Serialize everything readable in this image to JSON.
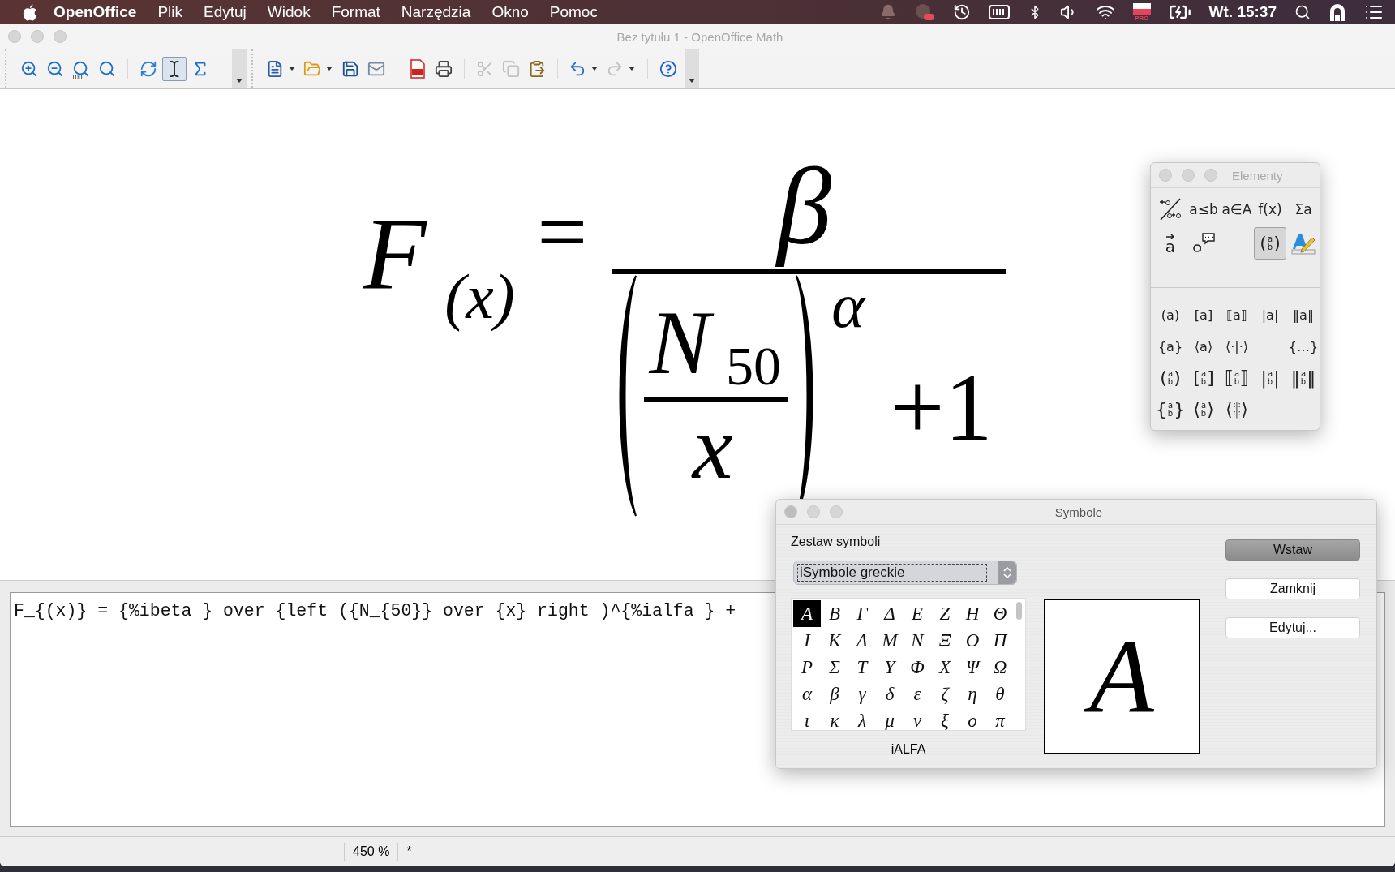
{
  "menu_bar": {
    "app": "OpenOffice",
    "menus": [
      "Plik",
      "Edytuj",
      "Widok",
      "Format",
      "Narzędzia",
      "Okno",
      "Pomoc"
    ],
    "flag_badge": "PRO",
    "clock": "Wt. 15:37"
  },
  "window": {
    "title": "Bez tytułu 1 - OpenOffice Math"
  },
  "toolbars": [
    {
      "items": [
        {
          "selected": false,
          "disabled": false,
          "dropdown": false
        },
        {
          "selected": false,
          "disabled": false,
          "dropdown": false
        },
        {
          "selected": false,
          "disabled": false,
          "dropdown": false,
          "label": "100"
        },
        {
          "selected": false,
          "disabled": false,
          "dropdown": false
        },
        {
          "selected": false,
          "disabled": false,
          "dropdown": false
        },
        {
          "selected": true,
          "disabled": false,
          "dropdown": false
        },
        {
          "selected": false,
          "disabled": false,
          "dropdown": false
        }
      ]
    },
    {
      "items": [
        {
          "selected": false,
          "disabled": false,
          "dropdown": true
        },
        {
          "selected": false,
          "disabled": false,
          "dropdown": true
        },
        {
          "selected": false,
          "disabled": false,
          "dropdown": false
        },
        {
          "selected": false,
          "disabled": false,
          "dropdown": false
        },
        {
          "selected": false,
          "disabled": false,
          "dropdown": false
        },
        {
          "selected": false,
          "disabled": false,
          "dropdown": false
        },
        {
          "selected": false,
          "disabled": true,
          "dropdown": false
        },
        {
          "selected": false,
          "disabled": true,
          "dropdown": false
        },
        {
          "selected": false,
          "disabled": false,
          "dropdown": false
        },
        {
          "selected": false,
          "disabled": false,
          "dropdown": true
        },
        {
          "selected": false,
          "disabled": true,
          "dropdown": true
        },
        {
          "selected": false,
          "disabled": false,
          "dropdown": false
        }
      ]
    }
  ],
  "formula": {
    "function": "F",
    "argument": "(x)",
    "equals": "=",
    "numerator": "β",
    "inner_numerator": "N",
    "inner_subscript": "50",
    "inner_denominator": "x",
    "exponent": "α",
    "addend": "+1"
  },
  "editor": {
    "text": "F_{(x)} = {%ibeta } over {left ({N_{50}} over {x} right )^{%ialfa } +"
  },
  "status_bar": {
    "zoom": "450 %",
    "modified": "*"
  },
  "elements_panel": {
    "title": "Elementy",
    "categories": [
      {
        "kind": "icon",
        "selected": false
      },
      {
        "kind": "text",
        "label": "a≤b",
        "selected": false
      },
      {
        "kind": "text",
        "label": "a∈A",
        "selected": false
      },
      {
        "kind": "text",
        "label": "f(x)",
        "selected": false
      },
      {
        "kind": "text",
        "label": "Σa",
        "selected": false
      },
      {
        "kind": "vector",
        "label": "a",
        "selected": false
      },
      {
        "kind": "icon",
        "selected": false
      },
      {
        "kind": "blank"
      },
      {
        "kind": "stack",
        "open": "(",
        "top": "a",
        "bottom": "b",
        "close": ")",
        "selected": true
      },
      {
        "kind": "icon",
        "selected": false
      }
    ],
    "brackets": [
      [
        {
          "kind": "single",
          "open": "(",
          "content": "a",
          "close": ")"
        },
        {
          "kind": "single",
          "open": "[",
          "content": "a",
          "close": "]"
        },
        {
          "kind": "single",
          "open": "⟦",
          "content": "a",
          "close": "⟧"
        },
        {
          "kind": "single",
          "open": "|",
          "content": "a",
          "close": "|"
        },
        {
          "kind": "single",
          "open": "‖",
          "content": "a",
          "close": "‖"
        }
      ],
      [
        {
          "kind": "single",
          "open": "{",
          "content": "a",
          "close": "}"
        },
        {
          "kind": "single",
          "open": "⟨",
          "content": "a",
          "close": "⟩"
        },
        {
          "kind": "single",
          "open": "⟨",
          "content": "·|·",
          "close": "⟩"
        },
        {
          "kind": "blank"
        },
        {
          "kind": "single",
          "open": "{",
          "content": "…",
          "close": "}"
        }
      ],
      [
        {
          "kind": "stack",
          "open": "(",
          "top": "a",
          "bottom": "b",
          "close": ")"
        },
        {
          "kind": "stack",
          "open": "[",
          "top": "a",
          "bottom": "b",
          "close": "]"
        },
        {
          "kind": "stack",
          "open": "⟦",
          "top": "a",
          "bottom": "b",
          "close": "⟧"
        },
        {
          "kind": "stack",
          "open": "|",
          "top": "a",
          "bottom": "b",
          "close": "|"
        },
        {
          "kind": "stack",
          "open": "‖",
          "top": "a",
          "bottom": "b",
          "close": "‖"
        }
      ],
      [
        {
          "kind": "stack",
          "open": "{",
          "top": "a",
          "bottom": "b",
          "close": "}"
        },
        {
          "kind": "stack",
          "open": "⟨",
          "top": "a",
          "bottom": "b",
          "close": "⟩"
        },
        {
          "kind": "stack",
          "open": "⟨",
          "top": "∶|∶",
          "bottom": "∶|∶",
          "close": "⟩"
        }
      ]
    ]
  },
  "symbols_dialog": {
    "title": "Symbole",
    "set_label": "Zestaw symboli",
    "set_value": "iSymbole greckie",
    "symbols": [
      {
        "char": "Α",
        "selected": true
      },
      {
        "char": "Β",
        "selected": false
      },
      {
        "char": "Γ",
        "selected": false
      },
      {
        "char": "Δ",
        "selected": false
      },
      {
        "char": "Ε",
        "selected": false
      },
      {
        "char": "Ζ",
        "selected": false
      },
      {
        "char": "Η",
        "selected": false
      },
      {
        "char": "Θ",
        "selected": false
      },
      {
        "char": "Ι",
        "selected": false
      },
      {
        "char": "Κ",
        "selected": false
      },
      {
        "char": "Λ",
        "selected": false
      },
      {
        "char": "Μ",
        "selected": false
      },
      {
        "char": "Ν",
        "selected": false
      },
      {
        "char": "Ξ",
        "selected": false
      },
      {
        "char": "Ο",
        "selected": false
      },
      {
        "char": "Π",
        "selected": false
      },
      {
        "char": "Ρ",
        "selected": false
      },
      {
        "char": "Σ",
        "selected": false
      },
      {
        "char": "Τ",
        "selected": false
      },
      {
        "char": "Υ",
        "selected": false
      },
      {
        "char": "Φ",
        "selected": false
      },
      {
        "char": "Χ",
        "selected": false
      },
      {
        "char": "Ψ",
        "selected": false
      },
      {
        "char": "Ω",
        "selected": false
      },
      {
        "char": "α",
        "selected": false
      },
      {
        "char": "β",
        "selected": false
      },
      {
        "char": "γ",
        "selected": false
      },
      {
        "char": "δ",
        "selected": false
      },
      {
        "char": "ε",
        "selected": false
      },
      {
        "char": "ζ",
        "selected": false
      },
      {
        "char": "η",
        "selected": false
      },
      {
        "char": "θ",
        "selected": false
      },
      {
        "char": "ι",
        "selected": false
      },
      {
        "char": "κ",
        "selected": false
      },
      {
        "char": "λ",
        "selected": false
      },
      {
        "char": "μ",
        "selected": false
      },
      {
        "char": "ν",
        "selected": false
      },
      {
        "char": "ξ",
        "selected": false
      },
      {
        "char": "ο",
        "selected": false
      },
      {
        "char": "π",
        "selected": false
      }
    ],
    "preview": "Α",
    "symbol_name": "iALFA",
    "buttons": [
      {
        "label": "Wstaw",
        "default": true
      },
      {
        "label": "Zamknij",
        "default": false
      },
      {
        "label": "Edytuj...",
        "default": false
      }
    ]
  }
}
